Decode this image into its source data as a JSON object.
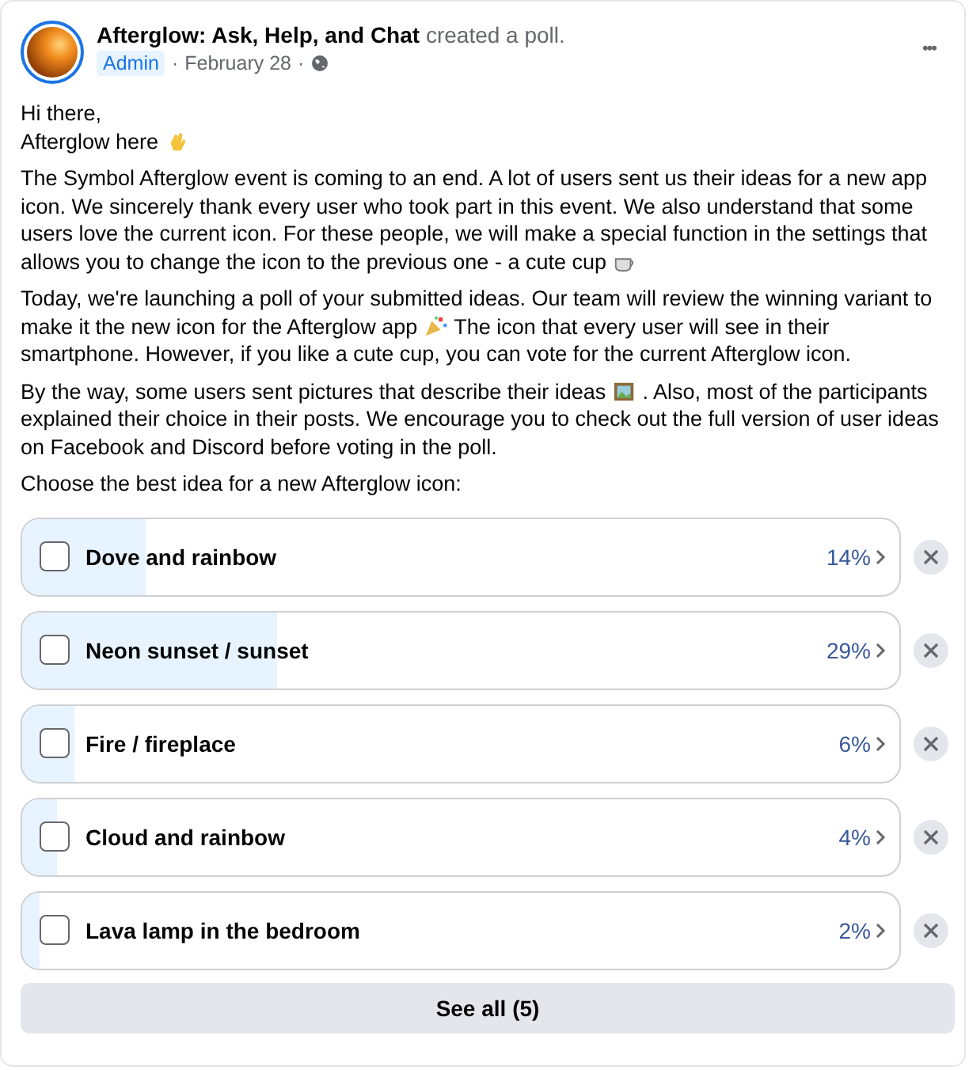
{
  "post": {
    "group": "Afterglow: Ask, Help, and Chat",
    "action": "created a poll.",
    "badge": "Admin",
    "separator_1": "·",
    "date": "February 28",
    "separator_2": "·",
    "more": "•••"
  },
  "paragraphs": [
    {
      "lines": [
        [
          {
            "kind": "text",
            "text": "Hi there,"
          }
        ],
        [
          {
            "kind": "text",
            "text": "Afterglow here"
          },
          {
            "kind": "emoji"
          }
        ]
      ]
    },
    {
      "lines": [
        [
          {
            "kind": "text",
            "text": "The Symbol Afterglow event is coming to an end. A lot of users sent us their ideas for a new app"
          }
        ],
        [
          {
            "kind": "text",
            "text": "icon. We sincerely thank every user who took part in this event. We also understand that some"
          }
        ],
        [
          {
            "kind": "text",
            "text": "users love the current icon. For these people, we will make a special function in the settings that"
          }
        ],
        [
          {
            "kind": "text",
            "text": "allows you to change the icon to the previous one - a cute cup"
          },
          {
            "kind": "emoji"
          }
        ]
      ]
    },
    {
      "lines": [
        [
          {
            "kind": "text",
            "text": "Today, we're launching a poll of your submitted ideas. Our team will review the winning variant to"
          }
        ],
        [
          {
            "kind": "text",
            "text": "make it the new icon for the Afterglow app"
          },
          {
            "kind": "emoji"
          },
          {
            "kind": "text",
            "text": "The icon that every user will see in their"
          }
        ],
        [
          {
            "kind": "text",
            "text": "smartphone. However, if you like a cute cup, you can vote for the current Afterglow icon."
          }
        ]
      ]
    },
    {
      "lines": [
        [
          {
            "kind": "text",
            "text": "By the way, some users sent pictures that describe their ideas"
          },
          {
            "kind": "emoji"
          },
          {
            "kind": "text",
            "text": ". Also, most of the participants"
          }
        ],
        [
          {
            "kind": "text",
            "text": "explained their choice in their posts. We encourage you to check out the full version of user ideas"
          }
        ],
        [
          {
            "kind": "text",
            "text": "on Facebook and Discord before voting in the poll."
          }
        ]
      ]
    },
    {
      "lines": [
        [
          {
            "kind": "text",
            "text": "Choose the best idea for a new Afterglow icon:"
          }
        ]
      ]
    }
  ],
  "poll": {
    "options": [
      {
        "label": "Dove and rainbow",
        "percent": "14%",
        "level": 0.14,
        "checked": false
      },
      {
        "label": "Neon sunset / sunset",
        "percent": "29%",
        "level": 0.29,
        "checked": false
      },
      {
        "label": "Fire / fireplace",
        "percent": "6%",
        "level": 0.06,
        "checked": false
      },
      {
        "label": "Cloud and rainbow",
        "percent": "4%",
        "level": 0.04,
        "checked": false
      },
      {
        "label": "Lava lamp in the bedroom",
        "percent": "2%",
        "level": 0.02,
        "checked": false
      }
    ],
    "see_all": "See all (5)"
  }
}
